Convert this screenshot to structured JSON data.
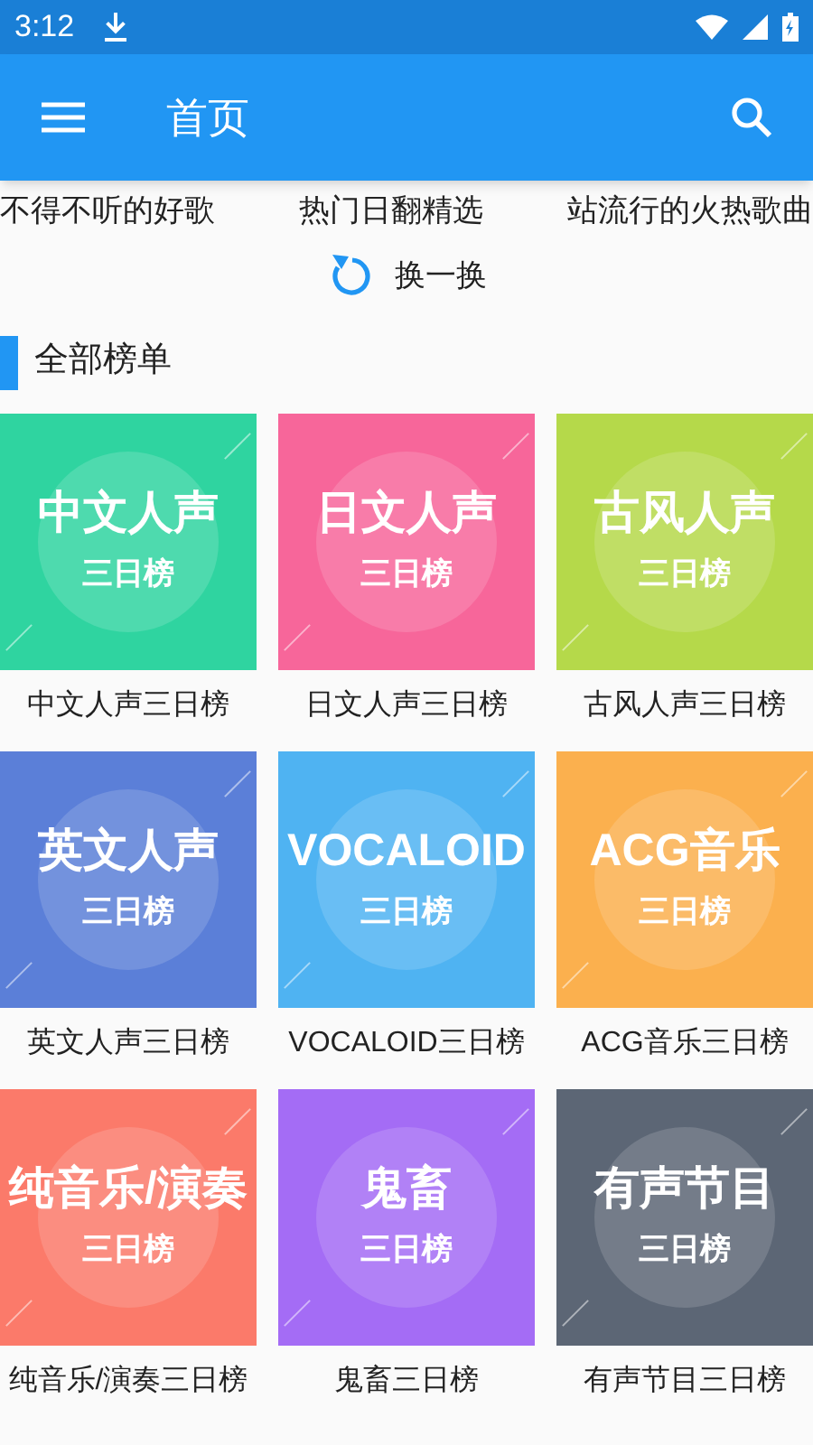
{
  "status_bar": {
    "time": "3:12"
  },
  "app_bar": {
    "title": "首页"
  },
  "recommend_row": [
    "不得不听的好歌",
    "热门日翻精选",
    "站流行的火热歌曲"
  ],
  "refresh": {
    "label": "换一换"
  },
  "section": {
    "title": "全部榜单"
  },
  "charts": [
    {
      "cover_title": "中文人声",
      "cover_subtitle": "三日榜",
      "label": "中文人声三日榜",
      "color": "#2fd4a0"
    },
    {
      "cover_title": "日文人声",
      "cover_subtitle": "三日榜",
      "label": "日文人声三日榜",
      "color": "#f7669a"
    },
    {
      "cover_title": "古风人声",
      "cover_subtitle": "三日榜",
      "label": "古风人声三日榜",
      "color": "#b5d94a"
    },
    {
      "cover_title": "英文人声",
      "cover_subtitle": "三日榜",
      "label": "英文人声三日榜",
      "color": "#5b7fd8"
    },
    {
      "cover_title": "VOCALOID",
      "cover_subtitle": "三日榜",
      "label": "VOCALOID三日榜",
      "color": "#4fb3f2"
    },
    {
      "cover_title": "ACG音乐",
      "cover_subtitle": "三日榜",
      "label": "ACG音乐三日榜",
      "color": "#fbb04e"
    },
    {
      "cover_title": "纯音乐/演奏",
      "cover_subtitle": "三日榜",
      "label": "纯音乐/演奏三日榜",
      "color": "#fb7a6a"
    },
    {
      "cover_title": "鬼畜",
      "cover_subtitle": "三日榜",
      "label": "鬼畜三日榜",
      "color": "#a46cf5"
    },
    {
      "cover_title": "有声节目",
      "cover_subtitle": "三日榜",
      "label": "有声节目三日榜",
      "color": "#5c6675"
    }
  ]
}
